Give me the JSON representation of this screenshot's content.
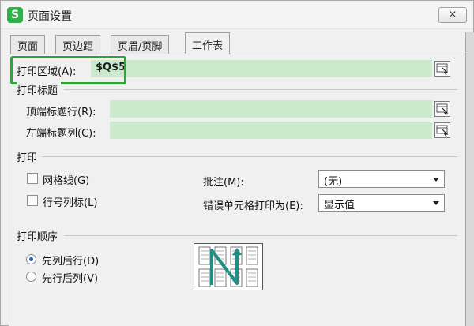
{
  "window": {
    "app_icon": "S",
    "title": "页面设置",
    "close_label": "×"
  },
  "tabs": [
    {
      "label": "页面"
    },
    {
      "label": "页边距"
    },
    {
      "label": "页眉/页脚"
    },
    {
      "label": "工作表",
      "active": true
    }
  ],
  "print_area": {
    "label": "打印区域(A):",
    "value": "$Q$5"
  },
  "print_titles": {
    "group_label": "打印标题",
    "rows_label": "顶端标题行(R):",
    "rows_value": "",
    "cols_label": "左端标题列(C):",
    "cols_value": ""
  },
  "print": {
    "group_label": "打印",
    "gridlines_label": "网格线(G)",
    "gridlines_checked": false,
    "headings_label": "行号列标(L)",
    "headings_checked": false,
    "comments_label": "批注(M):",
    "comments_value": "(无)",
    "errors_label": "错误单元格打印为(E):",
    "errors_value": "显示值"
  },
  "print_order": {
    "group_label": "打印顺序",
    "down_then_over_label": "先列后行(D)",
    "over_then_down_label": "先行后列(V)",
    "selected": "down_then_over"
  },
  "colors": {
    "field_green": "#cbe9cd",
    "highlight_green": "#2aa836",
    "app_icon_green": "#2fb34a"
  }
}
